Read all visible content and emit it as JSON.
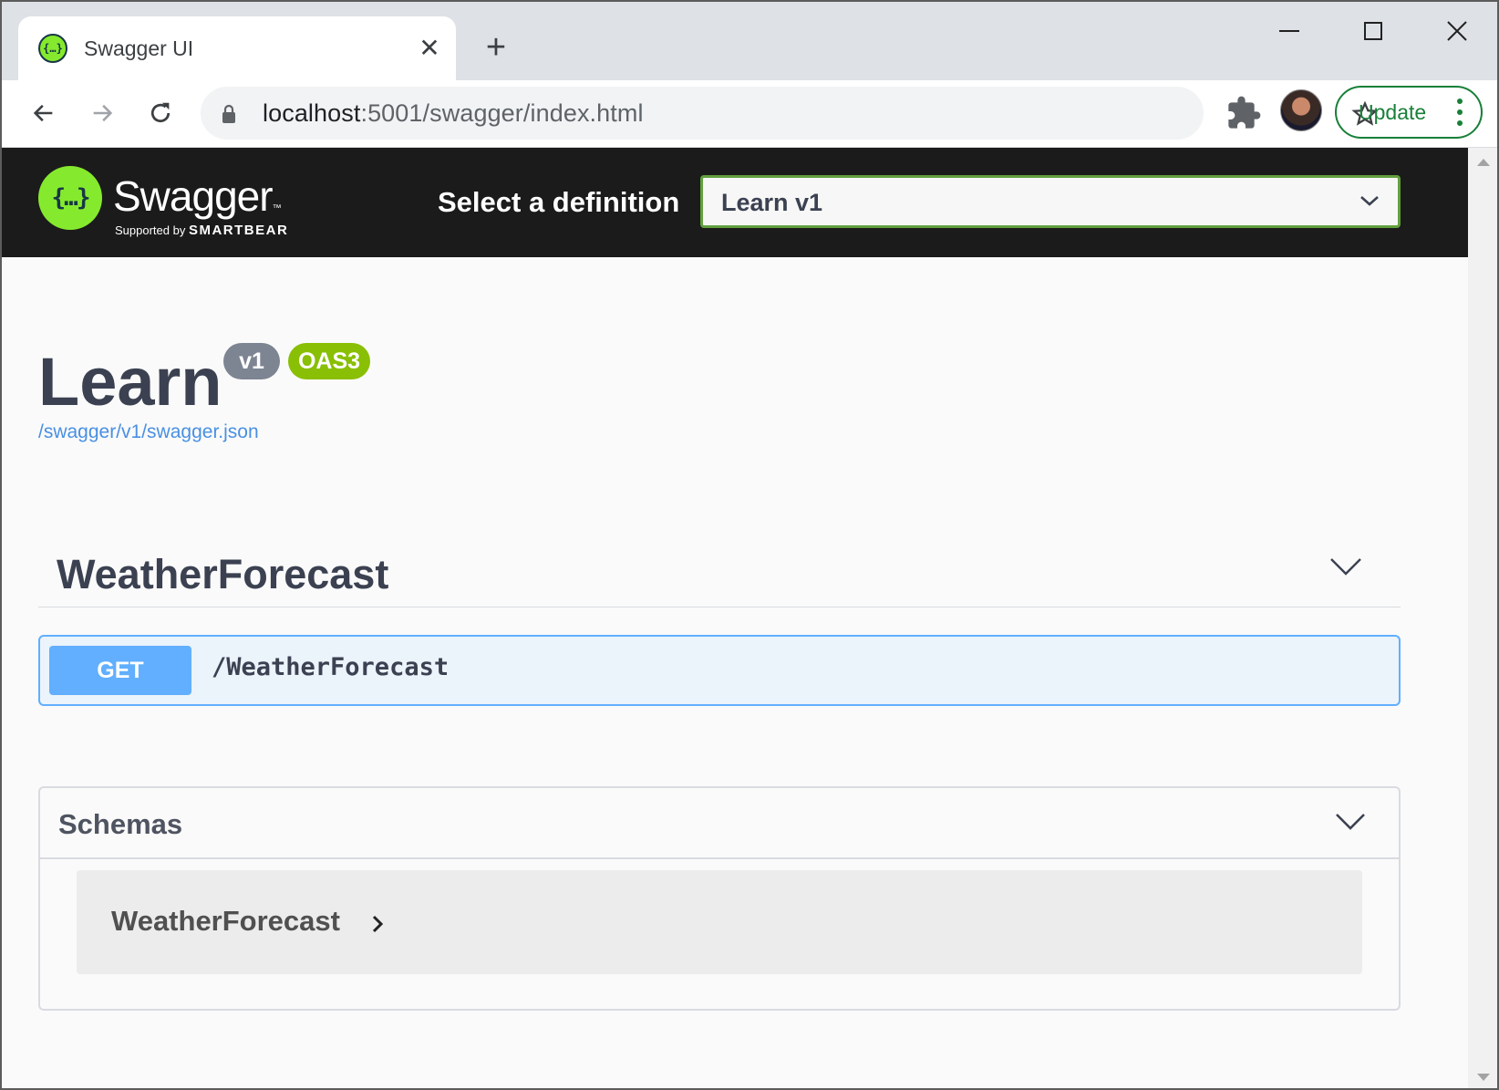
{
  "browser": {
    "tab": {
      "title": "Swagger UI",
      "favicon": "{…}"
    },
    "url": {
      "host": "localhost",
      "rest": ":5001/swagger/index.html"
    },
    "update_label": "Update",
    "icons": [
      "back-arrow-icon",
      "forward-arrow-icon",
      "reload-icon",
      "lock-icon",
      "star-icon",
      "extensions-puzzle-icon",
      "profile-avatar",
      "kebab-menu-icon"
    ]
  },
  "swagger": {
    "logo_glyph": "{…}",
    "brand": "Swagger",
    "brand_tm": "™",
    "supported_by": "Supported by",
    "supporter": "SMARTBEAR",
    "definition_label": "Select a definition",
    "definition_value": "Learn v1",
    "colors": {
      "topbar": "#1b1b1b",
      "brand_green": "#85ea2d",
      "select_border": "#62a03f",
      "get": "#61affe",
      "oas": "#89bf04",
      "version": "#7d8492",
      "link": "#4990e2"
    }
  },
  "info": {
    "title": "Learn",
    "version_badge": "v1",
    "oas_badge": "OAS3",
    "spec_url": "/swagger/v1/swagger.json"
  },
  "tags": [
    {
      "name": "WeatherForecast",
      "operations": [
        {
          "method": "GET",
          "path": "/WeatherForecast"
        }
      ]
    }
  ],
  "schemas": {
    "title": "Schemas",
    "models": [
      {
        "name": "WeatherForecast"
      }
    ]
  }
}
